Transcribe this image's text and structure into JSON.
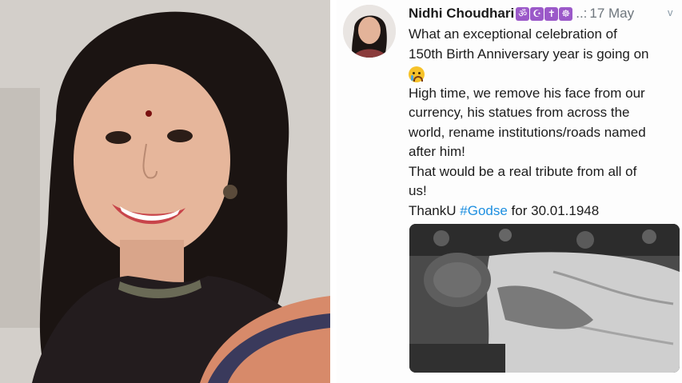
{
  "tweet": {
    "name": "Nidhi Choudhari",
    "emoji_badges": [
      "ॐ",
      "☪",
      "✝",
      "☸"
    ],
    "ellipsis": "..:",
    "date": "17 May",
    "chevron": "v",
    "lines": [
      "What an exceptional celebration of",
      "150th Birth Anniversary year is going on",
      "High time, we remove his face from our",
      "currency, his statues from across the",
      "world, rename institutions/roads named",
      "after him!",
      "That would be a real tribute from all of",
      "us!"
    ],
    "closing_prefix": "ThankU",
    "hashtag": "#Godse",
    "closing_suffix": "for 30.01.1948"
  },
  "icons": {
    "crying_emoji": "crying-face-icon",
    "chevron": "chevron-down-icon"
  },
  "colors": {
    "hashtag": "#1d8fe0",
    "name": "#1b1b1b",
    "meta": "#6e767d"
  }
}
